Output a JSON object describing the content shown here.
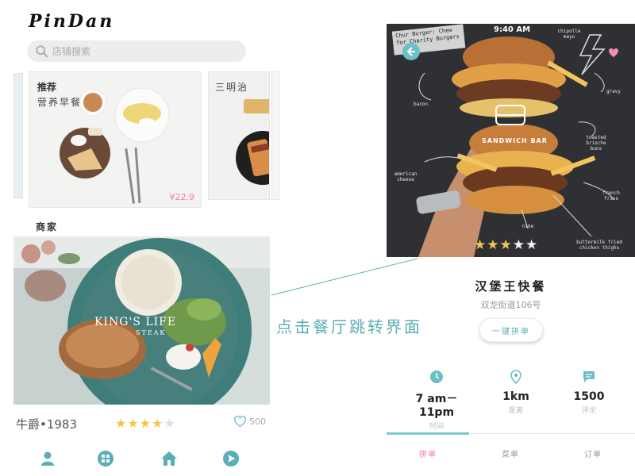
{
  "left_screen": {
    "brand": "PinDan",
    "search": {
      "placeholder": "店铺搜索",
      "icon": "search-icon"
    },
    "featured": {
      "label": "推荐",
      "title": "营养早餐",
      "price": "¥22.9"
    },
    "next_card": {
      "title": "三明治"
    },
    "merchants_title": "商家",
    "hero": {
      "title": "KING'S LIFE",
      "subtitle": "STEAK"
    },
    "merchant": {
      "name": "牛爵•1983",
      "rating": 4,
      "rating_max": 5,
      "likes": "500",
      "like_icon": "heart-outline-icon"
    },
    "nav": [
      {
        "icon": "user-icon"
      },
      {
        "icon": "grid-icon"
      },
      {
        "icon": "home-icon"
      },
      {
        "icon": "navigate-icon"
      }
    ]
  },
  "annotation": "点击餐厅跳转界面",
  "right_screen": {
    "status_time": "9:40 AM",
    "promo_text": "Chur Burger: Chew for Charity Burgers",
    "badge": "SANDWICH BAR",
    "image_labels": {
      "chipotle": "chipotle mayo",
      "bacon": "bacon",
      "gravy": "gravy",
      "brioche": "toasted brioche buns",
      "cheese": "american cheese",
      "fries": "french fries",
      "nike": "nike",
      "chicken": "buttermilk fried chicken thighs"
    },
    "image_rating": 3,
    "image_rating_max": 5,
    "restaurant_name": "汉堡王快餐",
    "address": "双龙街道106号",
    "group_button": "一键拼单",
    "stats": [
      {
        "icon": "clock-icon",
        "value": "7 am－11pm",
        "label": "时间"
      },
      {
        "icon": "location-pin-icon",
        "value": "1km",
        "label": "距离"
      },
      {
        "icon": "comment-icon",
        "value": "1500",
        "label": "评论"
      }
    ],
    "tabs": [
      {
        "label": "拼单",
        "active": true
      },
      {
        "label": "菜单",
        "active": false
      },
      {
        "label": "订单",
        "active": false
      }
    ]
  },
  "colors": {
    "accent": "#5aaeb7",
    "pink": "#ef7fa0",
    "star": "#f2c84b"
  }
}
